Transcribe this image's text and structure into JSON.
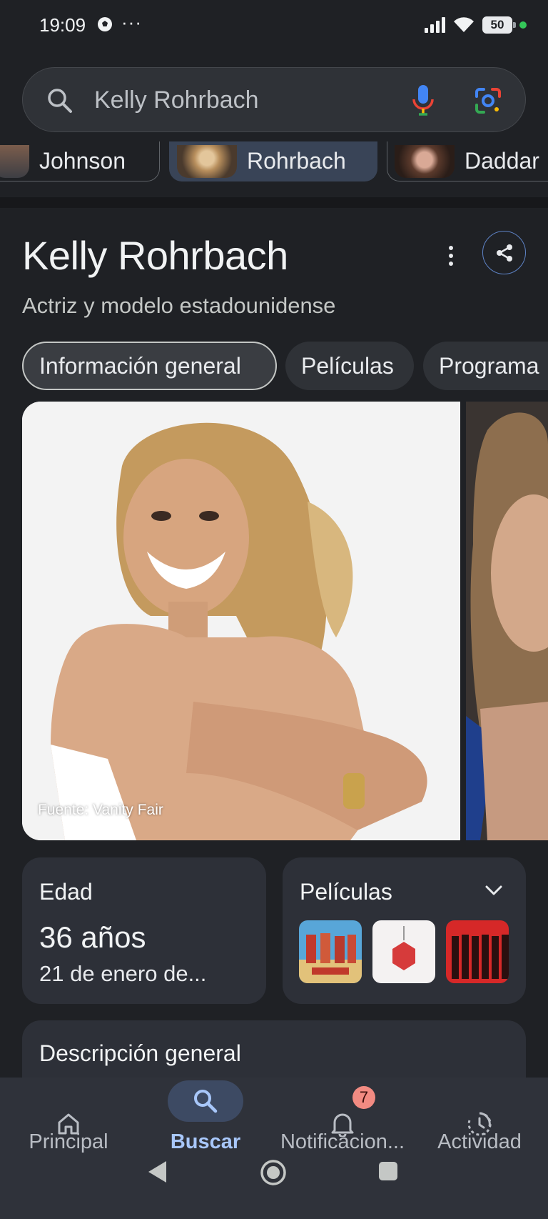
{
  "status_bar": {
    "time": "19:09",
    "overflow": "···",
    "battery": "50"
  },
  "search": {
    "query": "Kelly Rohrbach"
  },
  "related_people": [
    {
      "name": "Johnson"
    },
    {
      "name": "Rohrbach"
    },
    {
      "name": "Daddar"
    }
  ],
  "panel": {
    "title": "Kelly Rohrbach",
    "subtitle": "Actriz y modelo estadounidense",
    "tabs": [
      {
        "label": "Información general"
      },
      {
        "label": "Películas"
      },
      {
        "label": "Programa"
      }
    ],
    "image_source": "Fuente: Vanity Fair"
  },
  "age_card": {
    "label": "Edad",
    "value": "36 años",
    "detail": "21 de enero de..."
  },
  "films_card": {
    "label": "Películas"
  },
  "overview_card": {
    "label": "Descripción general"
  },
  "bottom_nav": {
    "items": [
      {
        "label": "Principal"
      },
      {
        "label": "Buscar"
      },
      {
        "label": "Notificacion..."
      },
      {
        "label": "Actividad"
      }
    ],
    "notification_count": "7"
  },
  "colors": {
    "accent": "#a8c7fa",
    "background": "#1f2125",
    "card": "#2d3038",
    "badge": "#f28b82"
  }
}
